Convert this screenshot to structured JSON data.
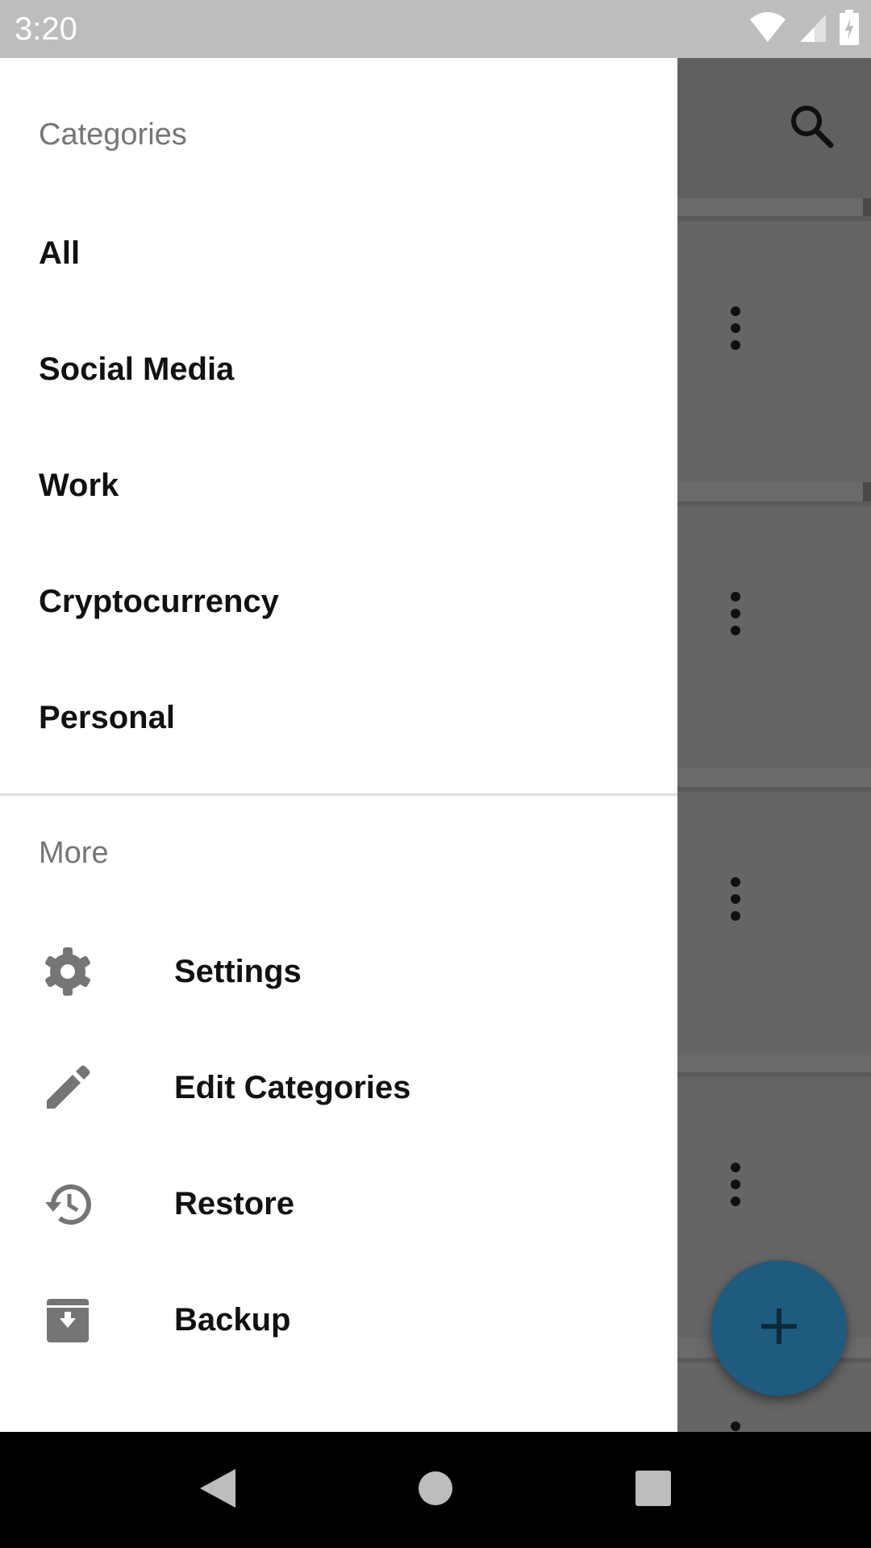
{
  "status_bar": {
    "time": "3:20",
    "icons": [
      "wifi-icon",
      "cellular-signal-icon",
      "battery-charging-icon"
    ]
  },
  "app": {
    "toolbar_icon": "search-icon",
    "entry_count_visible": 5,
    "fab_icon": "add-icon",
    "fab_color": "#1e5b7e"
  },
  "drawer": {
    "categories_header": "Categories",
    "categories": [
      {
        "label": "All"
      },
      {
        "label": "Social Media"
      },
      {
        "label": "Work"
      },
      {
        "label": "Cryptocurrency"
      },
      {
        "label": "Personal"
      }
    ],
    "more_header": "More",
    "more_items": [
      {
        "label": "Settings",
        "icon": "gear-icon"
      },
      {
        "label": "Edit Categories",
        "icon": "pencil-icon"
      },
      {
        "label": "Restore",
        "icon": "history-icon"
      },
      {
        "label": "Backup",
        "icon": "archive-icon"
      }
    ]
  },
  "nav_bar": {
    "buttons": [
      "back-icon",
      "home-icon",
      "recents-icon"
    ]
  }
}
